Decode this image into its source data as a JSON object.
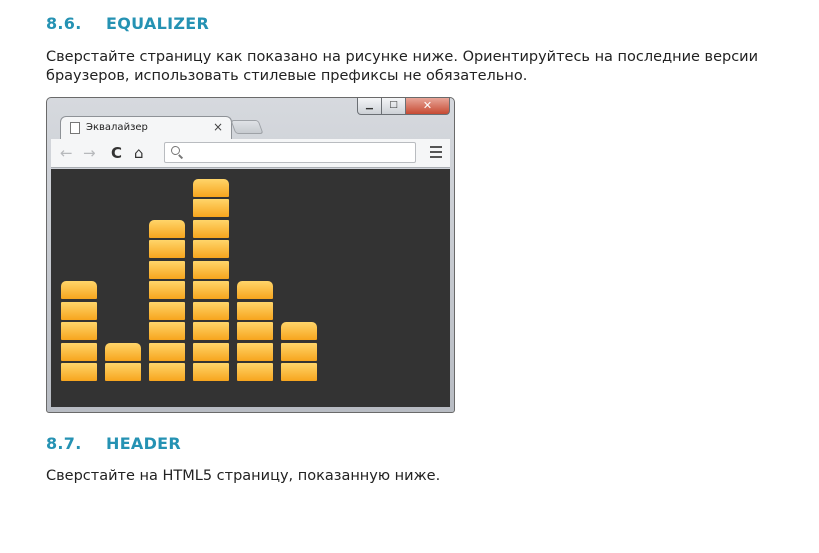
{
  "section_86": {
    "number": "8.6.",
    "title": "EQUALIZER"
  },
  "instruction_86": "Сверстайте страницу как показано на рисунке ниже. Ориентируйтесь на последние версии браузеров, использовать стилевые префиксы не обязательно.",
  "instruction_86_line1": "Сверстайте страницу как показано на рисунке ниже. Ориентируйтесь на последние версии",
  "instruction_86_line2": "браузеров, использовать стилевые префиксы не обязательно.",
  "browser": {
    "tab_title": "Эквалайзер",
    "tab_close": "×",
    "window_controls": {
      "minimize": "▁",
      "maximize": "□",
      "close": "✕"
    },
    "toolbar": {
      "back": "←",
      "forward": "→",
      "reload": "C",
      "home": "⌂",
      "address": ""
    },
    "equalizer": {
      "bar_segments": [
        5,
        2,
        8,
        10,
        5,
        3
      ],
      "colors": {
        "top": "#ffd56a",
        "bottom": "#f7a51e",
        "background": "#333333"
      }
    }
  },
  "section_87": {
    "number": "8.7.",
    "title": "HEADER"
  },
  "instruction_87": "Сверстайте на HTML5 страницу, показанную ниже."
}
